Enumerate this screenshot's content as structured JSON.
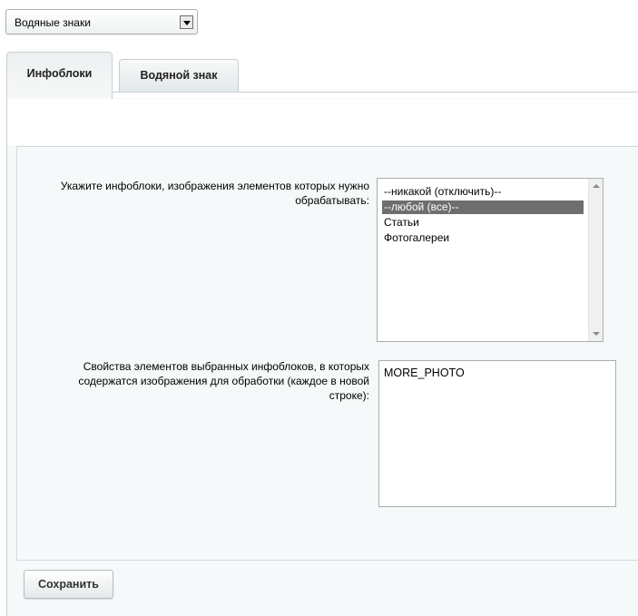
{
  "module_select": {
    "value": "Водяные знаки",
    "icon": "chevron-down-icon"
  },
  "tabs": [
    {
      "label": "Инфоблоки",
      "active": true
    },
    {
      "label": "Водяной знак",
      "active": false
    }
  ],
  "form": {
    "iblocks_label": "Укажите инфоблоки, изображения элементов которых нужно обрабатывать:",
    "iblocks_options": [
      {
        "label": "--никакой (отключить)--",
        "selected": false
      },
      {
        "label": "--любой (все)--",
        "selected": true
      },
      {
        "label": "Статьи",
        "selected": false
      },
      {
        "label": "Фотогалереи",
        "selected": false
      }
    ],
    "properties_label": "Свойства элементов выбранных инфоблоков, в которых содержатся изображения для обработки (каждое в новой строке):",
    "properties_value": "MORE_PHOTO"
  },
  "save_label": "Сохранить",
  "colors": {
    "selected_option_bg": "#6e6e6e",
    "panel_bg": "#f5f9f9",
    "border": "#c7cfd2"
  }
}
